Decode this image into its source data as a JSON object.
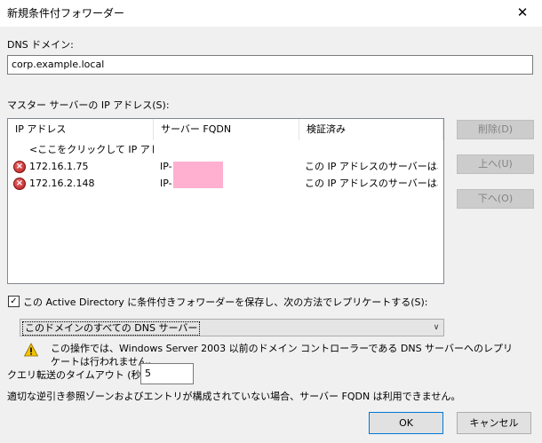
{
  "window": {
    "title": "新規条件付フォワーダー",
    "close_glyph": "✕"
  },
  "dns_domain": {
    "label": "DNS ドメイン:",
    "value": "corp.example.local"
  },
  "master_servers": {
    "label": "マスター サーバーの IP アドレス(S):",
    "columns": [
      "IP アドレス",
      "サーバー FQDN",
      "検証済み"
    ],
    "add_row_placeholder": "<ここをクリックして IP アドレ...",
    "rows": [
      {
        "ip": "172.16.1.75",
        "fqdn": "IP-",
        "validated": "この IP アドレスのサーバーは、...",
        "status_icon": "error-icon"
      },
      {
        "ip": "172.16.2.148",
        "fqdn": "IP-",
        "validated": "この IP アドレスのサーバーは、...",
        "status_icon": "error-icon"
      }
    ]
  },
  "side_buttons": {
    "delete": "削除(D)",
    "up": "上へ(U)",
    "down": "下へ(O)"
  },
  "replicate": {
    "checked": true,
    "check_mark": "✓",
    "label": "この Active Directory に条件付きフォワーダーを保存し、次の方法でレプリケートする(S):",
    "selected_option": "このドメインのすべての DNS サーバー",
    "dropdown_glyph": "∨"
  },
  "warning": {
    "line1": "この操作では、Windows Server 2003 以前のドメイン コントローラーである DNS サーバーへのレプリ",
    "line2": "ケートは行われません。"
  },
  "timeout": {
    "label": "クエリ転送のタイムアウト (秒):",
    "value": "5"
  },
  "note": "適切な逆引き参照ゾーンおよびエントリが構成されていない場合、サーバー FQDN は利用できません。",
  "footer": {
    "ok": "OK",
    "cancel": "キャンセル"
  },
  "colors": {
    "accent": "#0078d7",
    "error": "#c62828",
    "warning": "#f2c200",
    "redaction": "#ffb0d0"
  }
}
